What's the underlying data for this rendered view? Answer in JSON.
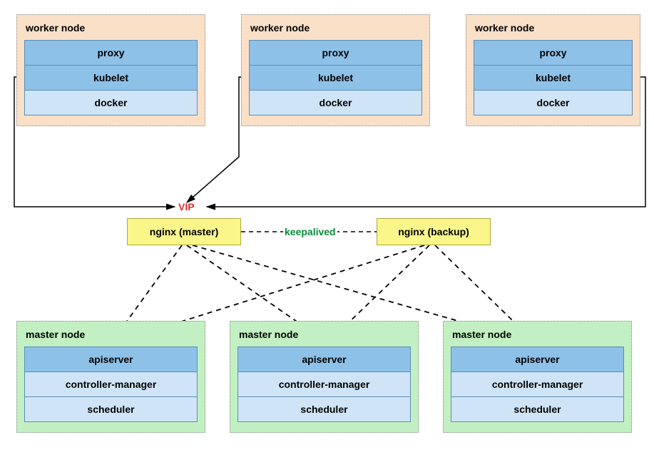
{
  "workers": [
    {
      "title": "worker node",
      "cells": [
        "proxy",
        "kubelet",
        "docker"
      ]
    },
    {
      "title": "worker node",
      "cells": [
        "proxy",
        "kubelet",
        "docker"
      ]
    },
    {
      "title": "worker node",
      "cells": [
        "proxy",
        "kubelet",
        "docker"
      ]
    }
  ],
  "vip_label": "VIP",
  "lb": {
    "master": "nginx (master)",
    "backup": "nginx (backup)",
    "link_label": "keepalived"
  },
  "masters": [
    {
      "title": "master node",
      "cells": [
        "apiserver",
        "controller-manager",
        "scheduler"
      ]
    },
    {
      "title": "master node",
      "cells": [
        "apiserver",
        "controller-manager",
        "scheduler"
      ]
    },
    {
      "title": "master node",
      "cells": [
        "apiserver",
        "controller-manager",
        "scheduler"
      ]
    }
  ]
}
